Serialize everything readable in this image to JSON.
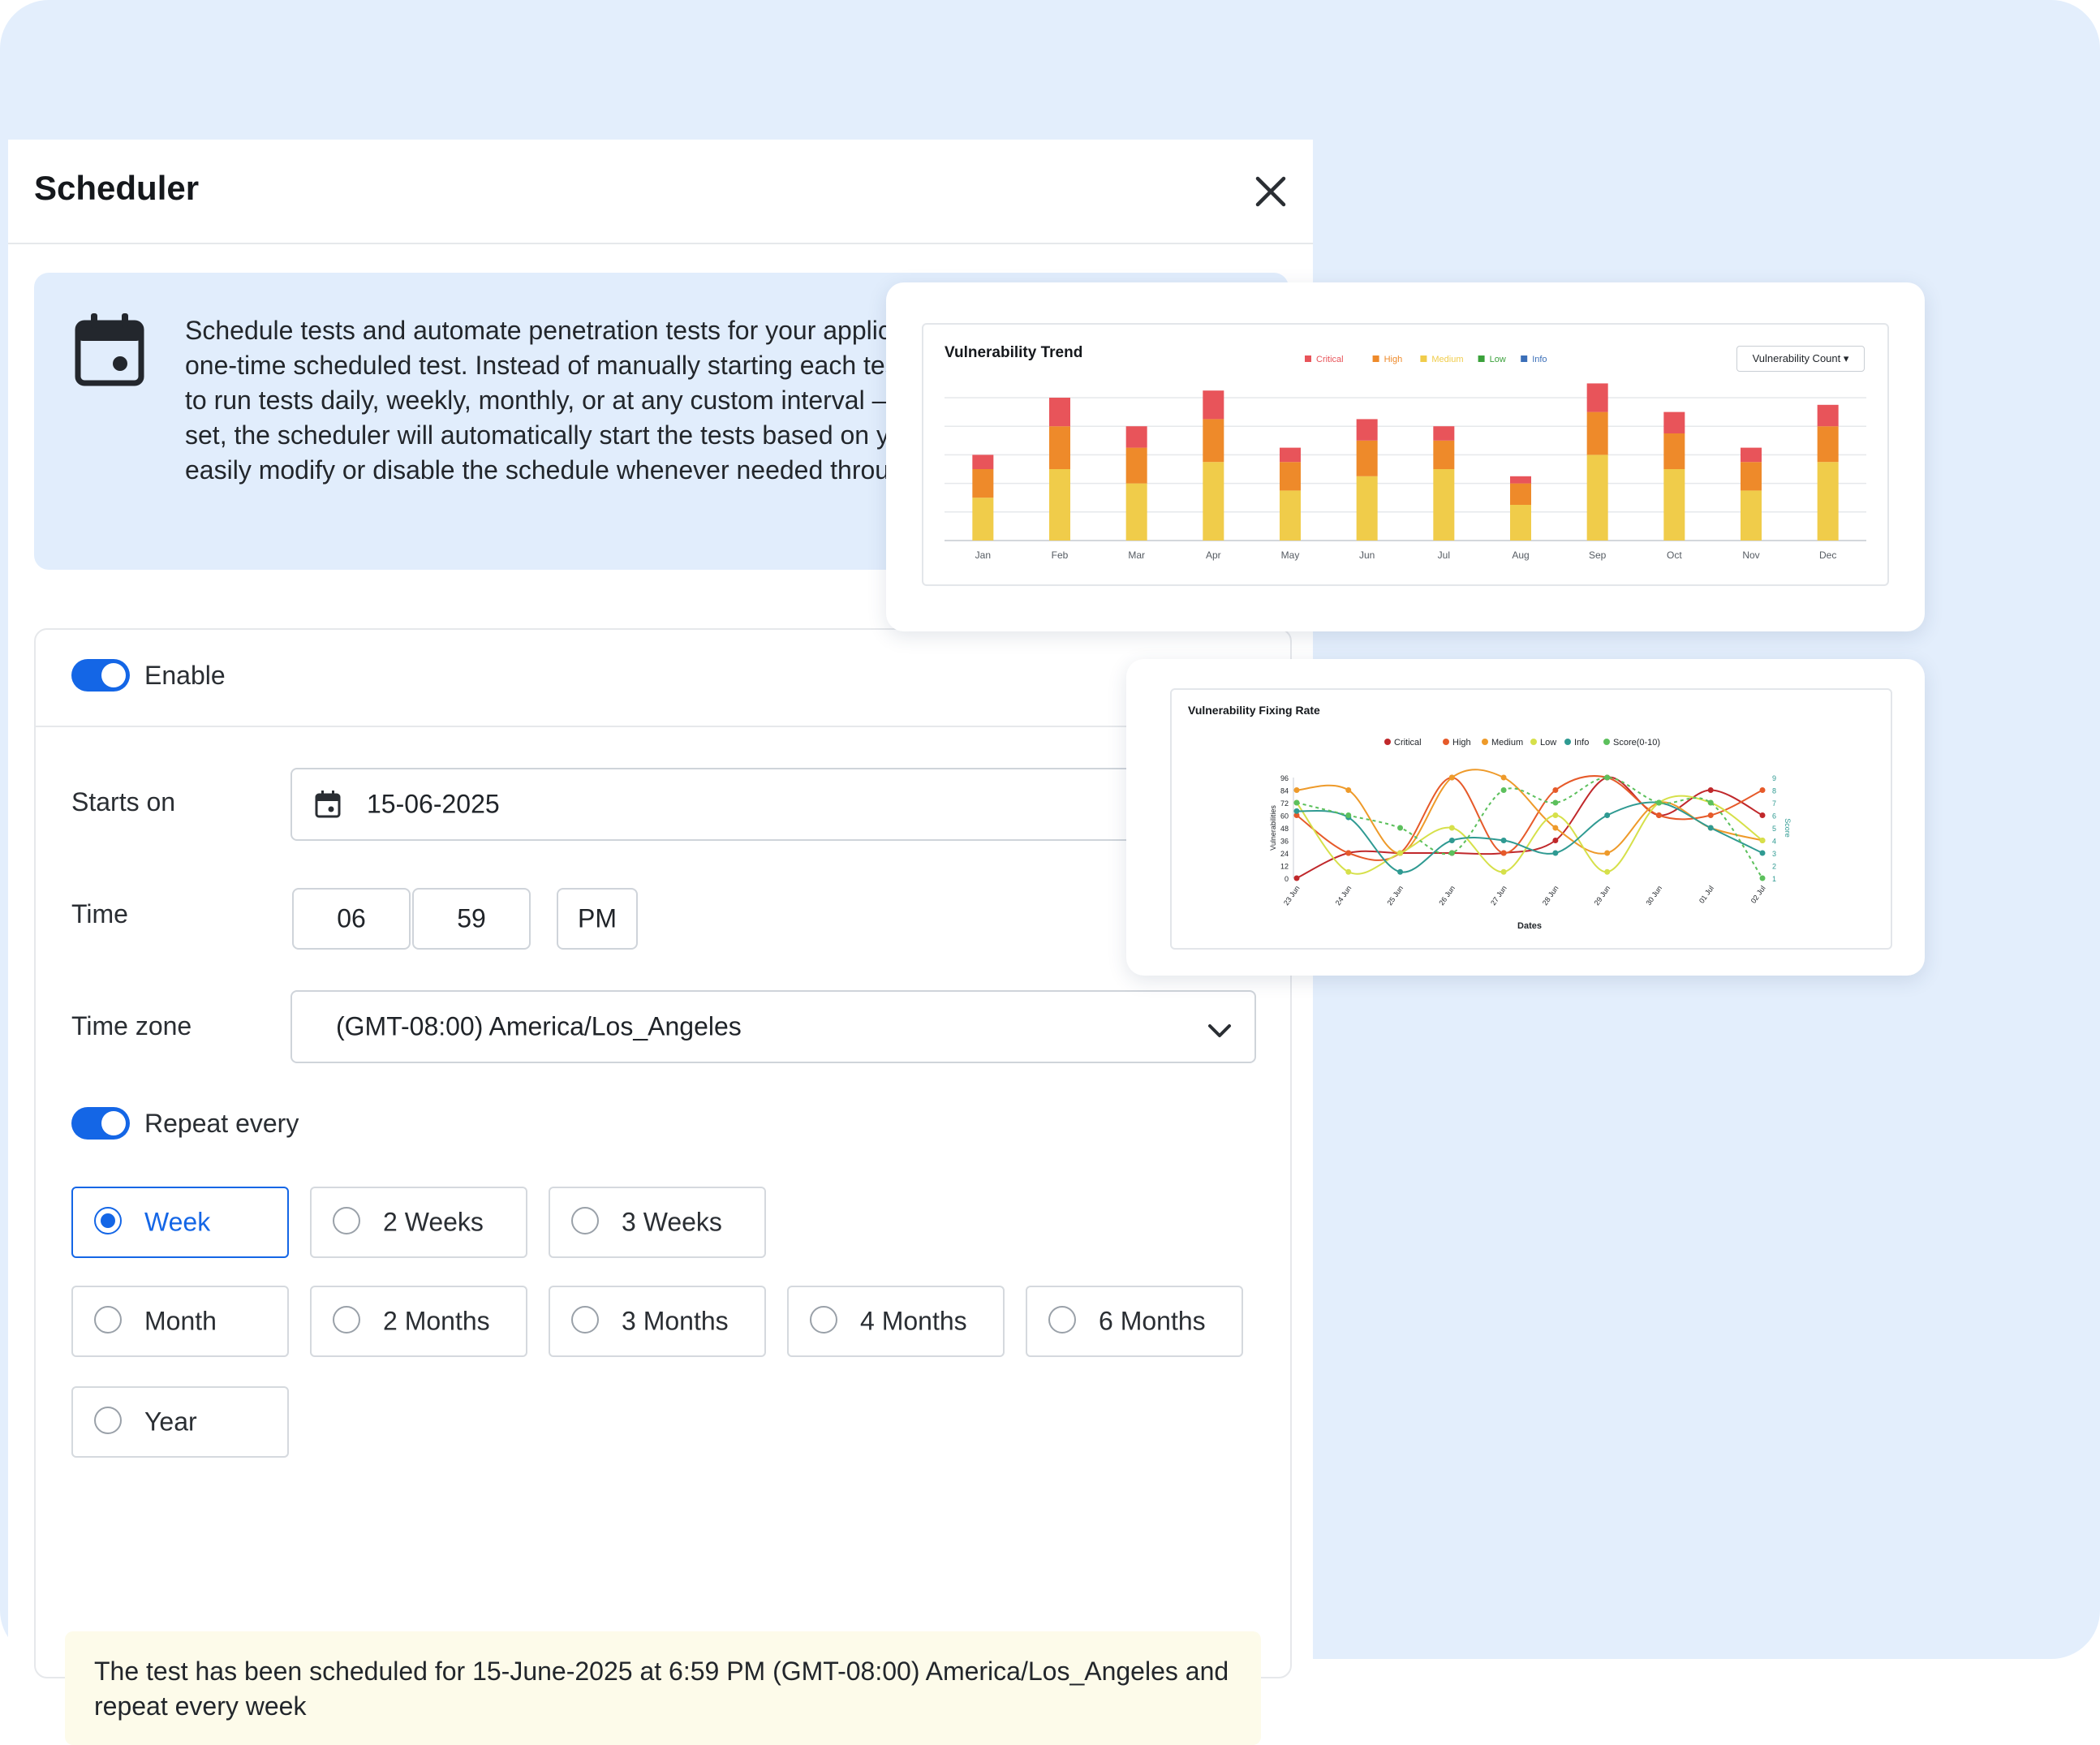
{
  "scheduler": {
    "title": "Scheduler",
    "info_text": "Schedule tests and automate penetration tests for your application on a recurring basis or as a one-time scheduled test. Instead of manually starting each test, you can configure the scheduler to run tests daily, weekly, monthly, or at any custom interval — depending on your needs. Once set, the scheduler will automatically start the tests based on your chosen schedule. You can easily modify or disable the schedule whenever needed through your application settings.",
    "enable_label": "Enable",
    "starts_on_label": "Starts on",
    "starts_on_value": "15-06-2025",
    "time_label": "Time",
    "time_hour": "06",
    "time_minute": "59",
    "time_ampm": "PM",
    "timezone_label": "Time zone",
    "timezone_value": "(GMT-08:00) America/Los_Angeles",
    "repeat_label": "Repeat every",
    "repeat_options": [
      "Week",
      "2 Weeks",
      "3 Weeks",
      "Month",
      "2 Months",
      "3 Months",
      "4 Months",
      "6 Months",
      "Year"
    ],
    "repeat_selected": "Week",
    "notice": "The test has been scheduled for 15-June-2025 at 6:59 PM (GMT-08:00) America/Los_Angeles and repeat every week"
  },
  "colors": {
    "accent": "#1466e6",
    "critical": "#e8545a",
    "high": "#ee8a2a",
    "medium": "#f0cc4a",
    "low": "#3aa13a",
    "info": "#3b6fb8"
  },
  "chart_data": [
    {
      "type": "bar",
      "title": "Vulnerability Trend",
      "dropdown_label": "Vulnerability Count",
      "legend_position": "top-center",
      "grid": true,
      "categories": [
        "Jan",
        "Feb",
        "Mar",
        "Apr",
        "May",
        "Jun",
        "Jul",
        "Aug",
        "Sep",
        "Oct",
        "Nov",
        "Dec"
      ],
      "ylim": [
        0,
        100
      ],
      "series": [
        {
          "name": "Critical",
          "color": "#e8545a",
          "values": [
            10,
            20,
            15,
            20,
            10,
            15,
            10,
            5,
            20,
            15,
            10,
            15
          ]
        },
        {
          "name": "High",
          "color": "#ee8a2a",
          "values": [
            20,
            30,
            25,
            30,
            20,
            25,
            20,
            15,
            30,
            25,
            20,
            25
          ]
        },
        {
          "name": "Medium",
          "color": "#f0cc4a",
          "values": [
            30,
            50,
            40,
            55,
            35,
            45,
            50,
            25,
            60,
            50,
            35,
            55
          ]
        },
        {
          "name": "Low",
          "color": "#3aa13a",
          "values": [
            0,
            0,
            0,
            0,
            0,
            0,
            0,
            0,
            0,
            0,
            0,
            0
          ]
        },
        {
          "name": "Info",
          "color": "#3b6fb8",
          "values": [
            0,
            0,
            0,
            0,
            0,
            0,
            0,
            0,
            0,
            0,
            0,
            0
          ]
        }
      ]
    },
    {
      "type": "line",
      "title": "Vulnerability Fixing Rate",
      "xlabel": "Dates",
      "ylabel": "Vulnerabilities",
      "y2label": "Score",
      "legend_position": "top-center",
      "x": [
        "23 Jun",
        "24 Jun",
        "25 Jun",
        "26 Jun",
        "27 Jun",
        "28 Jun",
        "29 Jun",
        "30 Jun",
        "01 Jul",
        "02 Jul"
      ],
      "yticks": [
        0,
        12,
        24,
        36,
        48,
        60,
        72,
        84,
        96
      ],
      "y2ticks": [
        1,
        2,
        3,
        4,
        5,
        6,
        7,
        8,
        9
      ],
      "ylim": [
        0,
        96
      ],
      "series": [
        {
          "name": "Critical",
          "color": "#c0282b",
          "dashed": false,
          "values": [
            0,
            24,
            24,
            24,
            24,
            36,
            96,
            60,
            84,
            60
          ]
        },
        {
          "name": "High",
          "color": "#e65a2a",
          "dashed": false,
          "values": [
            60,
            24,
            24,
            96,
            24,
            84,
            96,
            60,
            60,
            84
          ]
        },
        {
          "name": "Medium",
          "color": "#ee9a2a",
          "dashed": false,
          "values": [
            84,
            84,
            24,
            96,
            96,
            48,
            24,
            72,
            48,
            36
          ]
        },
        {
          "name": "Low",
          "color": "#d6e04a",
          "dashed": false,
          "values": [
            72,
            6,
            24,
            48,
            6,
            60,
            6,
            72,
            72,
            36
          ]
        },
        {
          "name": "Info",
          "color": "#2f9a92",
          "dashed": false,
          "values": [
            64,
            58,
            6,
            36,
            36,
            24,
            60,
            72,
            48,
            24
          ]
        },
        {
          "name": "Score(0-10)",
          "color": "#5cc05c",
          "dashed": true,
          "values": [
            7,
            6,
            5,
            3,
            8,
            7,
            9,
            7,
            7,
            1
          ]
        }
      ]
    }
  ]
}
